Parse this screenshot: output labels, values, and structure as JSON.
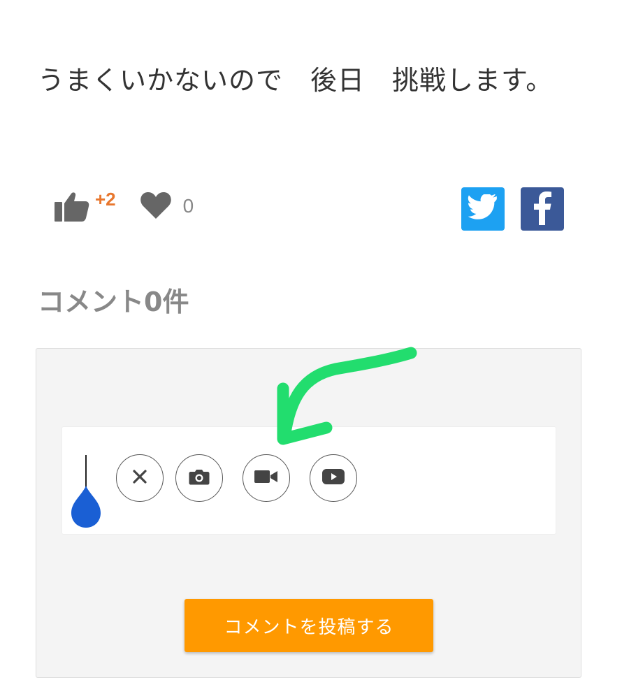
{
  "post": {
    "text": "うまくいかないので　後日　挑戦します。"
  },
  "reactions": {
    "like_count": "+2",
    "heart_count": "0",
    "like_icon": "thumbs-up-icon",
    "heart_icon": "heart-icon",
    "like_color": "#e8772e"
  },
  "share": {
    "twitter_icon": "twitter-icon",
    "facebook_icon": "facebook-icon",
    "twitter_color": "#1da1f2",
    "facebook_color": "#3b5998"
  },
  "comments": {
    "heading": "コメント0件"
  },
  "composer": {
    "tools": [
      {
        "name": "close",
        "icon": "close-icon"
      },
      {
        "name": "camera",
        "icon": "camera-icon"
      },
      {
        "name": "video",
        "icon": "video-camera-icon"
      },
      {
        "name": "youtube",
        "icon": "youtube-play-icon"
      }
    ],
    "submit_label": "コメントを投稿する",
    "submit_color": "#ff9900",
    "annotation_color": "#22dd6e"
  }
}
